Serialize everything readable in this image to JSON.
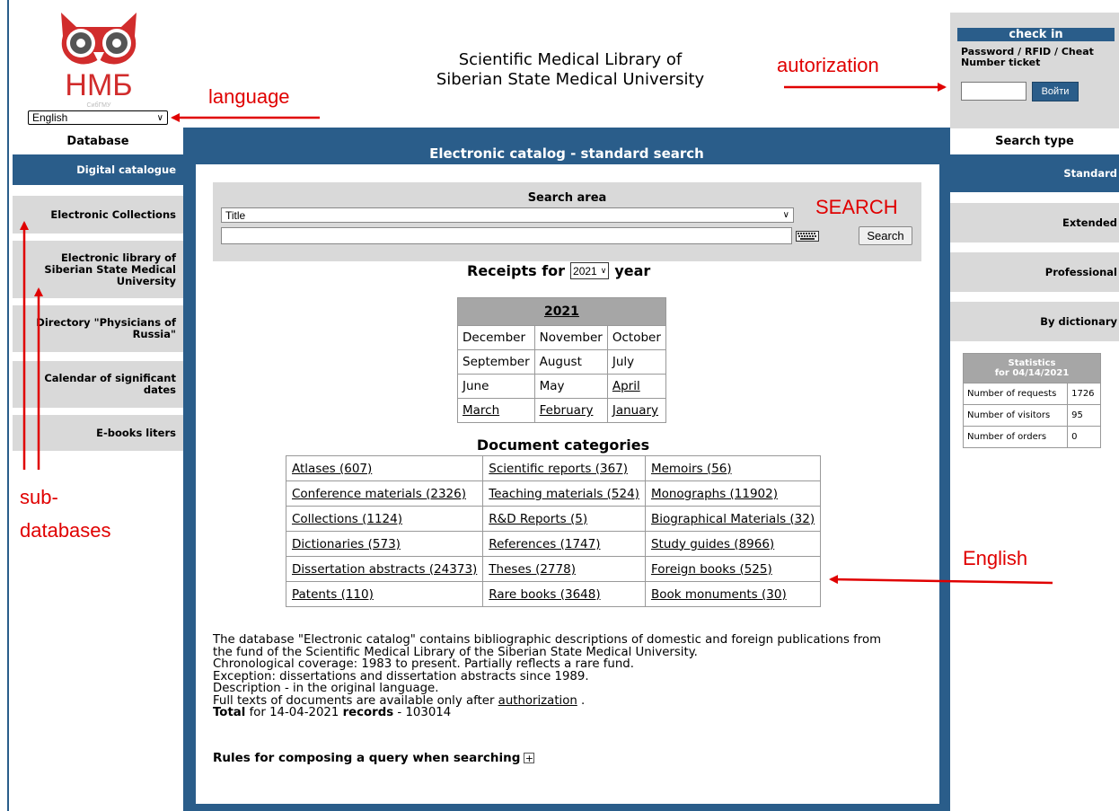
{
  "header": {
    "title_line1": "Scientific Medical Library of",
    "title_line2": "Siberian State Medical University",
    "logo_text": "НМБ",
    "logo_subtext": "СибГМУ",
    "language_select": "English"
  },
  "left_sidebar": {
    "heading": "Database",
    "items": [
      {
        "label": "Digital catalogue"
      },
      {
        "label": "Electronic Collections"
      },
      {
        "label": "Electronic library of Siberian State Medical University"
      },
      {
        "label": "Directory \"Physicians of Russia\""
      },
      {
        "label": "Calendar of significant dates"
      },
      {
        "label": "E-books liters"
      }
    ]
  },
  "main": {
    "title": "Electronic catalog - standard search",
    "search_area_label": "Search area",
    "search_field_select": "Title",
    "search_button": "Search",
    "receipts_prefix": "Receipts for",
    "receipts_year": "2021",
    "receipts_suffix": "year",
    "months_year_header": "2021",
    "months": [
      "December",
      "November",
      "October",
      "September",
      "August",
      "July",
      "June",
      "May",
      "April",
      "March",
      "February",
      "January"
    ],
    "doc_categories_title": "Document categories",
    "categories": [
      [
        "Atlases (607)",
        "Scientific reports (367)",
        "Memoirs (56)"
      ],
      [
        "Conference materials (2326)",
        "Teaching materials (524)",
        "Monographs (11902)"
      ],
      [
        "Collections (1124)",
        "R&D Reports (5)",
        "Biographical Materials (32)"
      ],
      [
        "Dictionaries (573)",
        "References (1747)",
        "Study guides (8966)"
      ],
      [
        "Dissertation abstracts (24373)",
        "Theses (2778)",
        "Foreign books (525)"
      ],
      [
        "Patents (110)",
        "Rare books (3648)",
        "Book monuments (30)"
      ]
    ],
    "description": {
      "line1": "The database \"Electronic catalog\" contains bibliographic descriptions of domestic and foreign publications from",
      "line2": "the fund of the Scientific Medical Library of the Siberian State Medical University.",
      "line3": "Chronological coverage: 1983 to present. Partially reflects a rare fund.",
      "line4": "Exception: dissertations and dissertation abstracts since 1989.",
      "line5": "Description - in the original language.",
      "line6_prefix": "Full texts of documents are available only after",
      "line6_link": "authorization",
      "line6_suffix": ".",
      "total_label": "Total",
      "total_mid": "for 14-04-2021",
      "records_label": "records",
      "records_value": "- 103014"
    },
    "rules_label": "Rules for composing a query when searching",
    "rules_toggle": "+"
  },
  "right_sidebar": {
    "checkin_title": "check in",
    "checkin_note": "Password / RFID / Cheat Number ticket",
    "login_button": "Войти",
    "search_type_heading": "Search type",
    "search_types": [
      "Standard",
      "Extended",
      "Professional",
      "By dictionary"
    ],
    "stats": {
      "title_line1": "Statistics",
      "title_line2": "for 04/14/2021",
      "rows": [
        {
          "label": "Number of requests",
          "value": "1726"
        },
        {
          "label": "Number of visitors",
          "value": "95"
        },
        {
          "label": "Number of orders",
          "value": "0"
        }
      ]
    }
  },
  "annotations": {
    "language": "language",
    "autorization": "autorization",
    "search": "SEARCH",
    "sub": "sub-",
    "databases": "databases",
    "english": "English",
    "color": "#e00000"
  },
  "colors": {
    "primary_blue": "#2a5d8a",
    "panel_gray": "#d9d9d9",
    "header_gray": "#a6a6a6",
    "logo_red": "#d12c2c"
  }
}
